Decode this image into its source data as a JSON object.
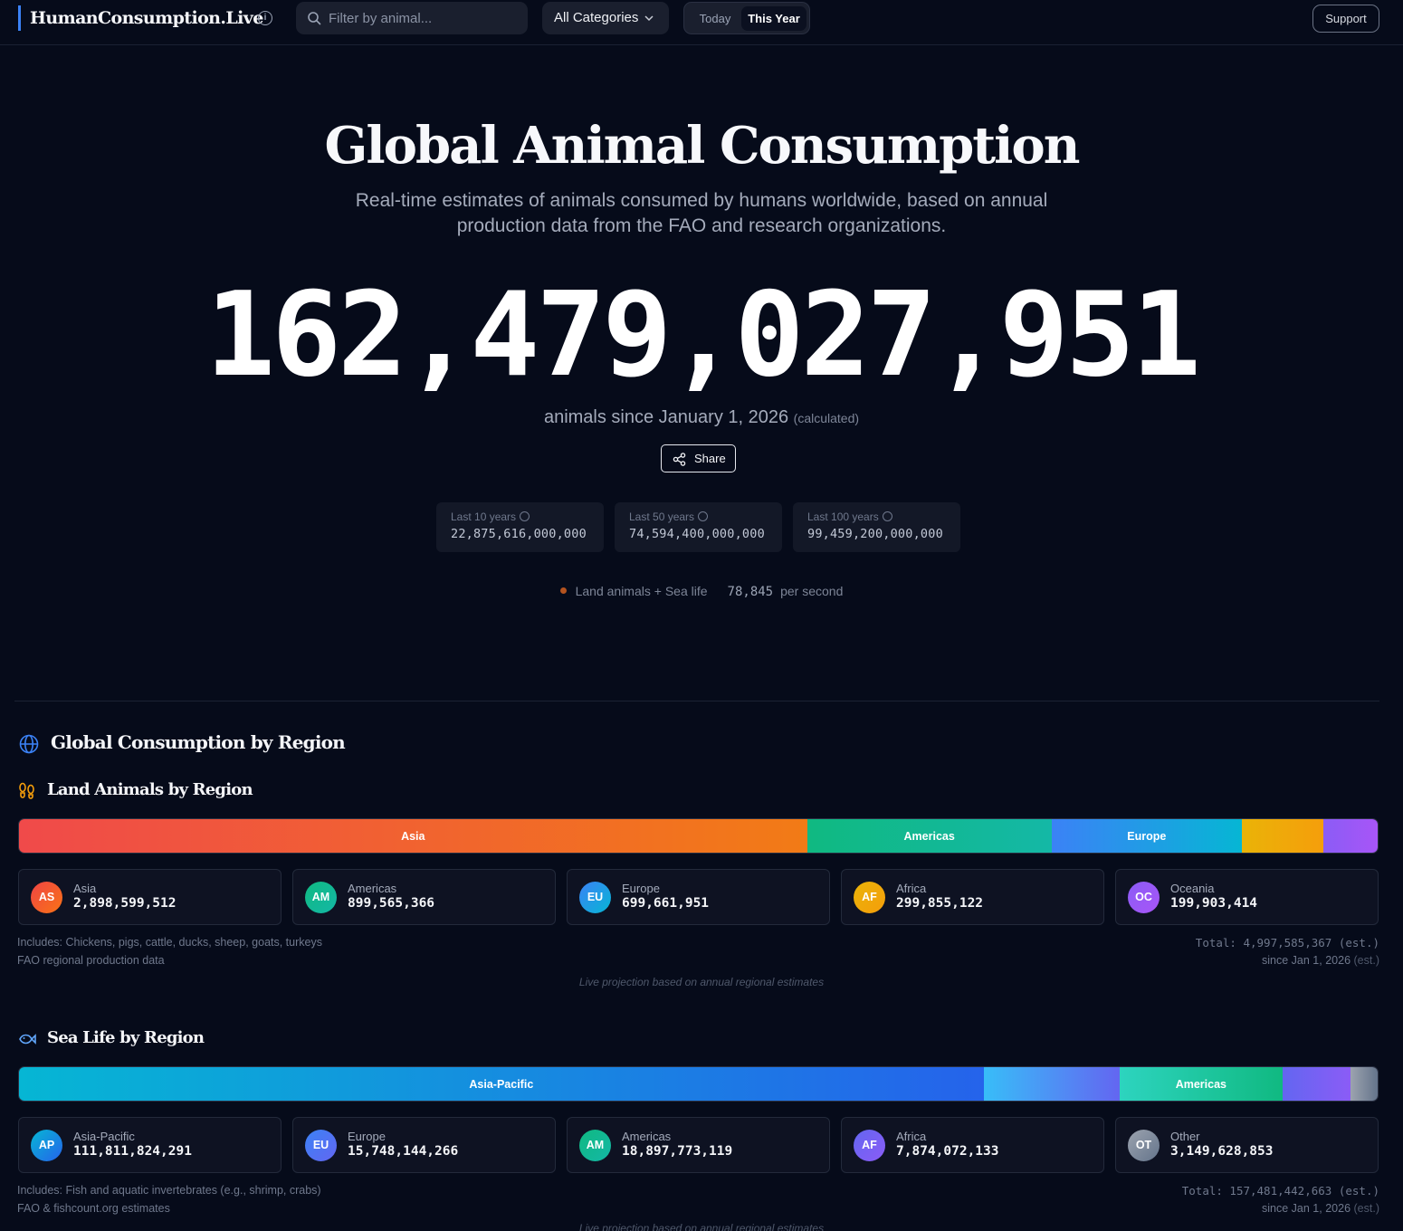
{
  "header": {
    "brand": "HumanConsumption.Live",
    "search_placeholder": "Filter by animal...",
    "category": "All Categories",
    "period_options": [
      "Today",
      "This Year"
    ],
    "period_selected": "This Year",
    "support_label": "Support"
  },
  "hero": {
    "title": "Global Animal Consumption",
    "subtitle": "Real-time estimates of animals consumed by humans worldwide, based on annual production data from the FAO and research organizations.",
    "counter": "162,479,027,951",
    "since_text": "animals since January 1, 2026",
    "since_note": "(calculated)",
    "share_label": "Share",
    "history": [
      {
        "label": "Last 10 years",
        "value": "22,875,616,000,000"
      },
      {
        "label": "Last 50 years",
        "value": "74,594,400,000,000"
      },
      {
        "label": "Last 100 years",
        "value": "99,459,200,000,000"
      }
    ],
    "rate": {
      "label": "Land animals + Sea life",
      "value": "78,845",
      "unit": "per second"
    }
  },
  "regions": {
    "title": "Global Consumption by Region",
    "land": {
      "title": "Land Animals by Region",
      "bar": [
        {
          "label": "Asia",
          "value": 2898599512,
          "color": "#f04a4a",
          "color2": "#f27b16"
        },
        {
          "label": "Americas",
          "value": 899565366,
          "color": "#10b981",
          "color2": "#14b8a6"
        },
        {
          "label": "Europe",
          "value": 699661951,
          "color": "#3b82f6",
          "color2": "#06b6d4"
        },
        {
          "label": "",
          "value": 299855122,
          "color": "#eab308",
          "color2": "#f59e0b"
        },
        {
          "label": "",
          "value": 199903414,
          "color": "#8b5cf6",
          "color2": "#a855f7"
        }
      ],
      "cards": [
        {
          "abbr": "AS",
          "name": "Asia",
          "value": "2,898,599,512",
          "color": "#ef4444",
          "color2": "#f97316"
        },
        {
          "abbr": "AM",
          "name": "Americas",
          "value": "899,565,366",
          "color": "#10b981",
          "color2": "#14b8a6"
        },
        {
          "abbr": "EU",
          "name": "Europe",
          "value": "699,661,951",
          "color": "#3b82f6",
          "color2": "#06b6d4"
        },
        {
          "abbr": "AF",
          "name": "Africa",
          "value": "299,855,122",
          "color": "#eab308",
          "color2": "#f59e0b"
        },
        {
          "abbr": "OC",
          "name": "Oceania",
          "value": "199,903,414",
          "color": "#8b5cf6",
          "color2": "#a855f7"
        }
      ],
      "includes": "Includes: Chickens, pigs, cattle, ducks, sheep, goats, turkeys",
      "source": "FAO regional production data",
      "total": "Total: 4,997,585,367 (est.)",
      "since": "since Jan 1, 2026",
      "since_est": "(est.)",
      "live_note": "Live projection based on annual regional estimates"
    },
    "sea": {
      "title": "Sea Life by Region",
      "bar": [
        {
          "label": "Asia-Pacific",
          "value": 111811824291,
          "color": "#06b6d4",
          "color2": "#2563eb"
        },
        {
          "label": "",
          "value": 15748144266,
          "color": "#38bdf8",
          "color2": "#6366f1"
        },
        {
          "label": "Americas",
          "value": 18897773119,
          "color": "#2dd4bf",
          "color2": "#10b981"
        },
        {
          "label": "",
          "value": 7874072133,
          "color": "#6366f1",
          "color2": "#8b5cf6"
        },
        {
          "label": "",
          "value": 3149628853,
          "color": "#9ca3af",
          "color2": "#64748b"
        }
      ],
      "cards": [
        {
          "abbr": "AP",
          "name": "Asia-Pacific",
          "value": "111,811,824,291",
          "color": "#06b6d4",
          "color2": "#2563eb"
        },
        {
          "abbr": "EU",
          "name": "Europe",
          "value": "15,748,144,266",
          "color": "#3b82f6",
          "color2": "#6366f1"
        },
        {
          "abbr": "AM",
          "name": "Americas",
          "value": "18,897,773,119",
          "color": "#10b981",
          "color2": "#14b8a6"
        },
        {
          "abbr": "AF",
          "name": "Africa",
          "value": "7,874,072,133",
          "color": "#6366f1",
          "color2": "#8b5cf6"
        },
        {
          "abbr": "OT",
          "name": "Other",
          "value": "3,149,628,853",
          "color": "#9ca3af",
          "color2": "#64748b"
        }
      ],
      "includes": "Includes: Fish and aquatic invertebrates (e.g., shrimp, crabs)",
      "source": "FAO & fishcount.org estimates",
      "total": "Total: 157,481,442,663 (est.)",
      "since": "since Jan 1, 2026",
      "since_est": "(est.)",
      "live_note": "Live projection based on annual regional estimates"
    }
  }
}
